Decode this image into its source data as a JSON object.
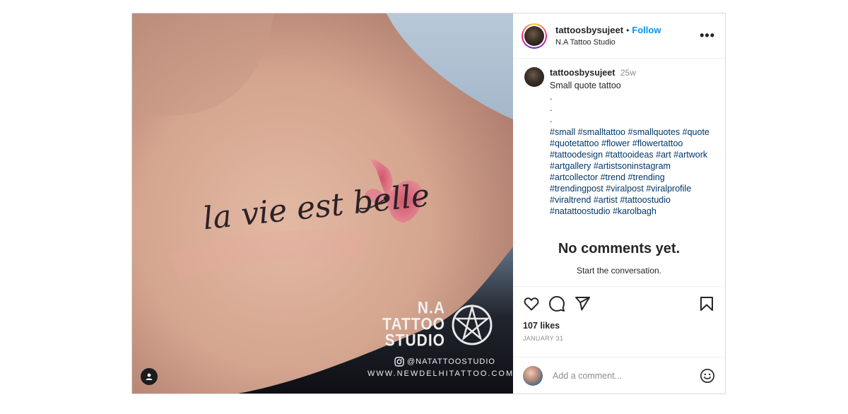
{
  "post": {
    "image": {
      "tattoo_text": "la vie est belle",
      "watermark": {
        "studio_name": "N.A\nTATTOO\nSTUDIO",
        "handle": "@NATATTOOSTUDIO",
        "website": "WWW.NEWDELHITATTOO.COM"
      }
    },
    "header": {
      "username": "tattoosbysujeet",
      "separator": "•",
      "follow_label": "Follow",
      "location": "N.A Tattoo Studio",
      "more_label": "•••"
    },
    "caption": {
      "username": "tattoosbysujeet",
      "time_ago": "25w",
      "text": "Small quote tattoo",
      "dots": [
        ".",
        ".",
        "."
      ],
      "hashtags": [
        "#small",
        "#smalltattoo",
        "#smallquotes",
        "#quote",
        "#quotetattoo",
        "#flower",
        "#flowertattoo",
        "#tattoodesign",
        "#tattooideas",
        "#art",
        "#artwork",
        "#artgallery",
        "#artistsoninstagram",
        "#artcollector",
        "#trend",
        "#trending",
        "#trendingpost",
        "#viralpost",
        "#viralprofile",
        "#viraltrend",
        "#artist",
        "#tattoostudio",
        "#natattoostudio",
        "#karolbagh"
      ]
    },
    "empty_state": {
      "title": "No comments yet.",
      "subtitle": "Start the conversation."
    },
    "actions": {
      "likes": "107 likes",
      "date": "JANUARY 31",
      "icons": [
        "heart-icon",
        "comment-icon",
        "share-icon",
        "bookmark-icon"
      ]
    },
    "comment_box": {
      "placeholder": "Add a comment...",
      "emoji_icon": "smiley-icon"
    }
  }
}
